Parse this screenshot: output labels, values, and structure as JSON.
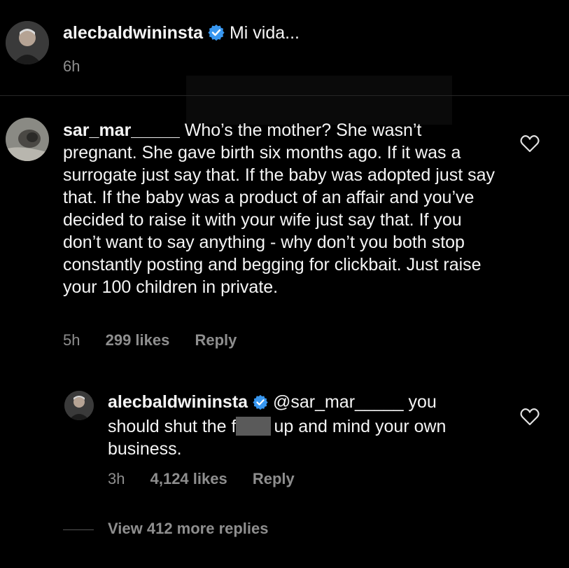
{
  "post": {
    "username": "alecbaldwininsta",
    "caption": "Mi vida...",
    "time": "6h"
  },
  "comment": {
    "username": "sar_mar_____",
    "text": "Who’s the mother? She wasn’t pregnant. She gave birth six months ago. If it was a surrogate just say that. If the baby was adopted just say that. If the baby was a product of an affair and you’ve decided to raise it with your wife just say that. If you don’t want to say anything - why don’t you both stop constantly posting and begging for clickbait. Just raise your 100 children in private.",
    "time": "5h",
    "likes": "299 likes",
    "reply_label": "Reply"
  },
  "reply": {
    "username": "alecbaldwininsta",
    "mention": "@sar_mar_____",
    "text_before": "you should shut the f",
    "text_after": "up and mind your own business.",
    "time": "3h",
    "likes": "4,124 likes",
    "reply_label": "Reply"
  },
  "view_more": "View 412 more replies",
  "colors": {
    "background": "#000000",
    "text": "#f5f5f5",
    "muted": "#8e8e8e",
    "verified": "#3897f0"
  },
  "icons": {
    "verified": "verified-badge-icon",
    "like": "heart-outline-icon"
  }
}
